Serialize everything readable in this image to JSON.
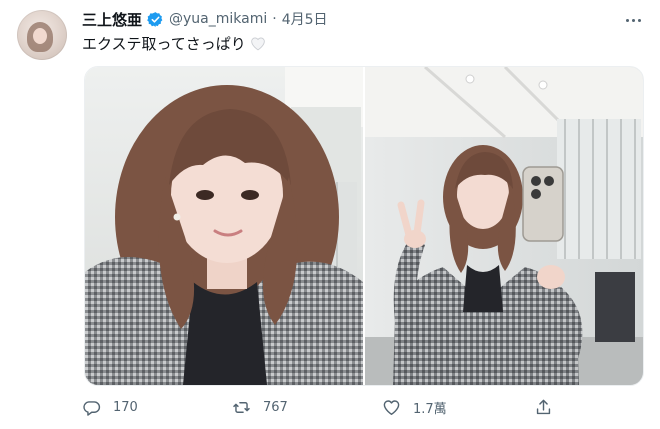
{
  "tweet": {
    "display_name": "三上悠亜",
    "handle": "@yua_mikami",
    "separator": "·",
    "date": "4月5日",
    "text": "エクステ取ってさっぱり"
  },
  "media": {
    "photos": [
      {
        "icon": "selfie-photo"
      },
      {
        "icon": "mirror-selfie-photo"
      }
    ]
  },
  "actions": {
    "replies": "170",
    "retweets": "767",
    "likes": "1.7萬"
  },
  "colors": {
    "verified_blue": "#1d9bf0",
    "text_primary": "#0f1419",
    "text_secondary": "#536471"
  }
}
